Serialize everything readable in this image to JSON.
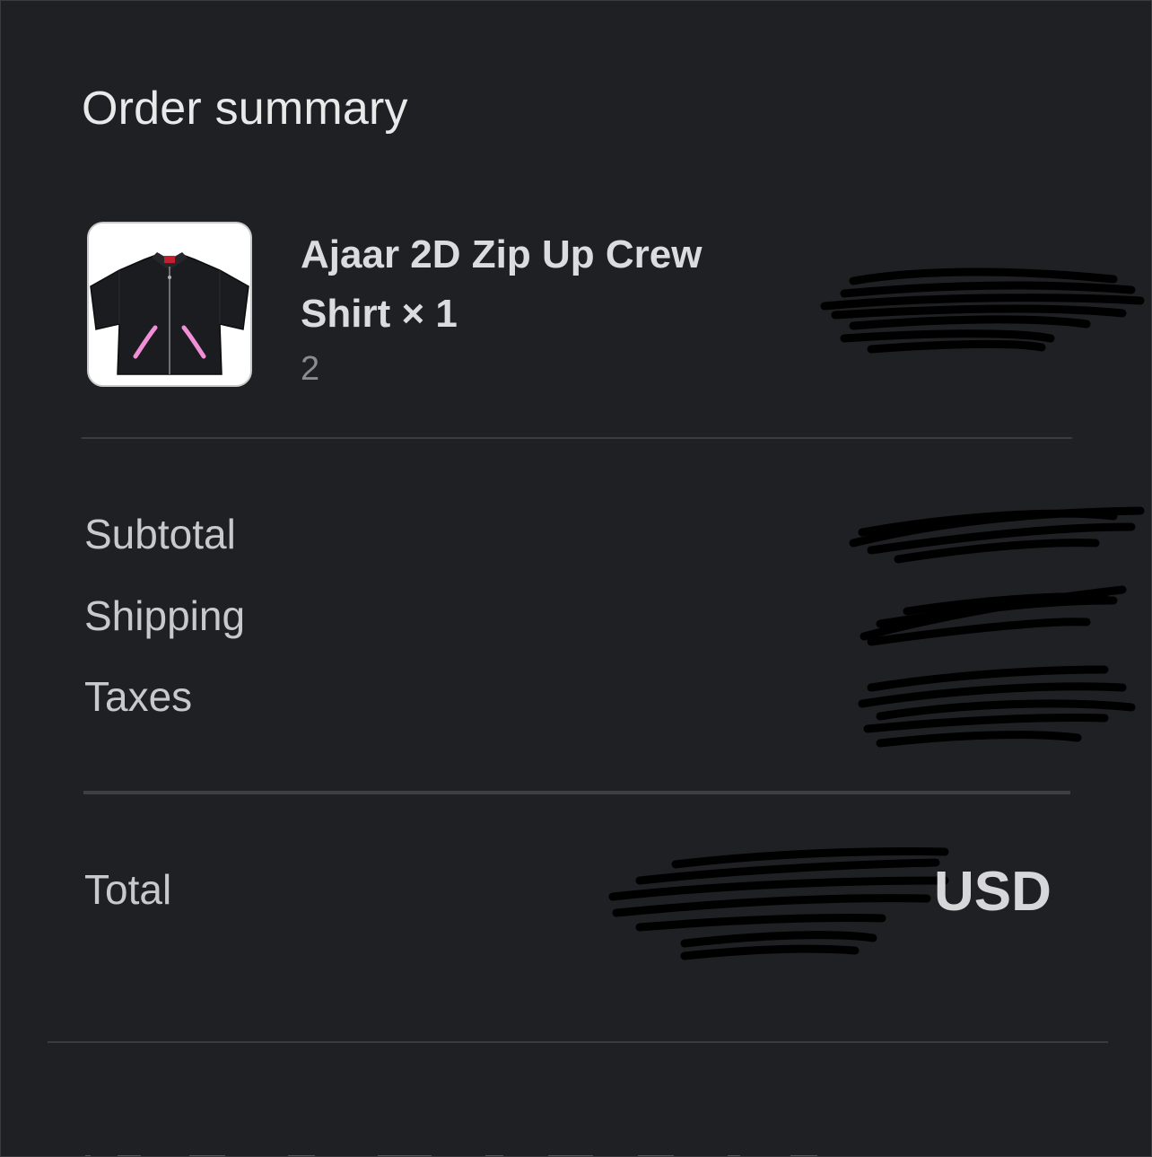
{
  "summary": {
    "title": "Order summary"
  },
  "item": {
    "name": "Ajaar 2D Zip Up Crew Shirt × 1",
    "variant": "2",
    "thumbnail": "black-zip-up-shirt-with-pink-pocket-trim"
  },
  "costs": {
    "subtotal_label": "Subtotal",
    "shipping_label": "Shipping",
    "taxes_label": "Taxes",
    "total_label": "Total",
    "total_currency": "USD"
  },
  "colors": {
    "background": "#1f2023",
    "text_primary": "#e9e9ea",
    "text_muted": "#8b8c90",
    "divider": "#3b3c40",
    "pocket_trim": "#f08fd8"
  }
}
